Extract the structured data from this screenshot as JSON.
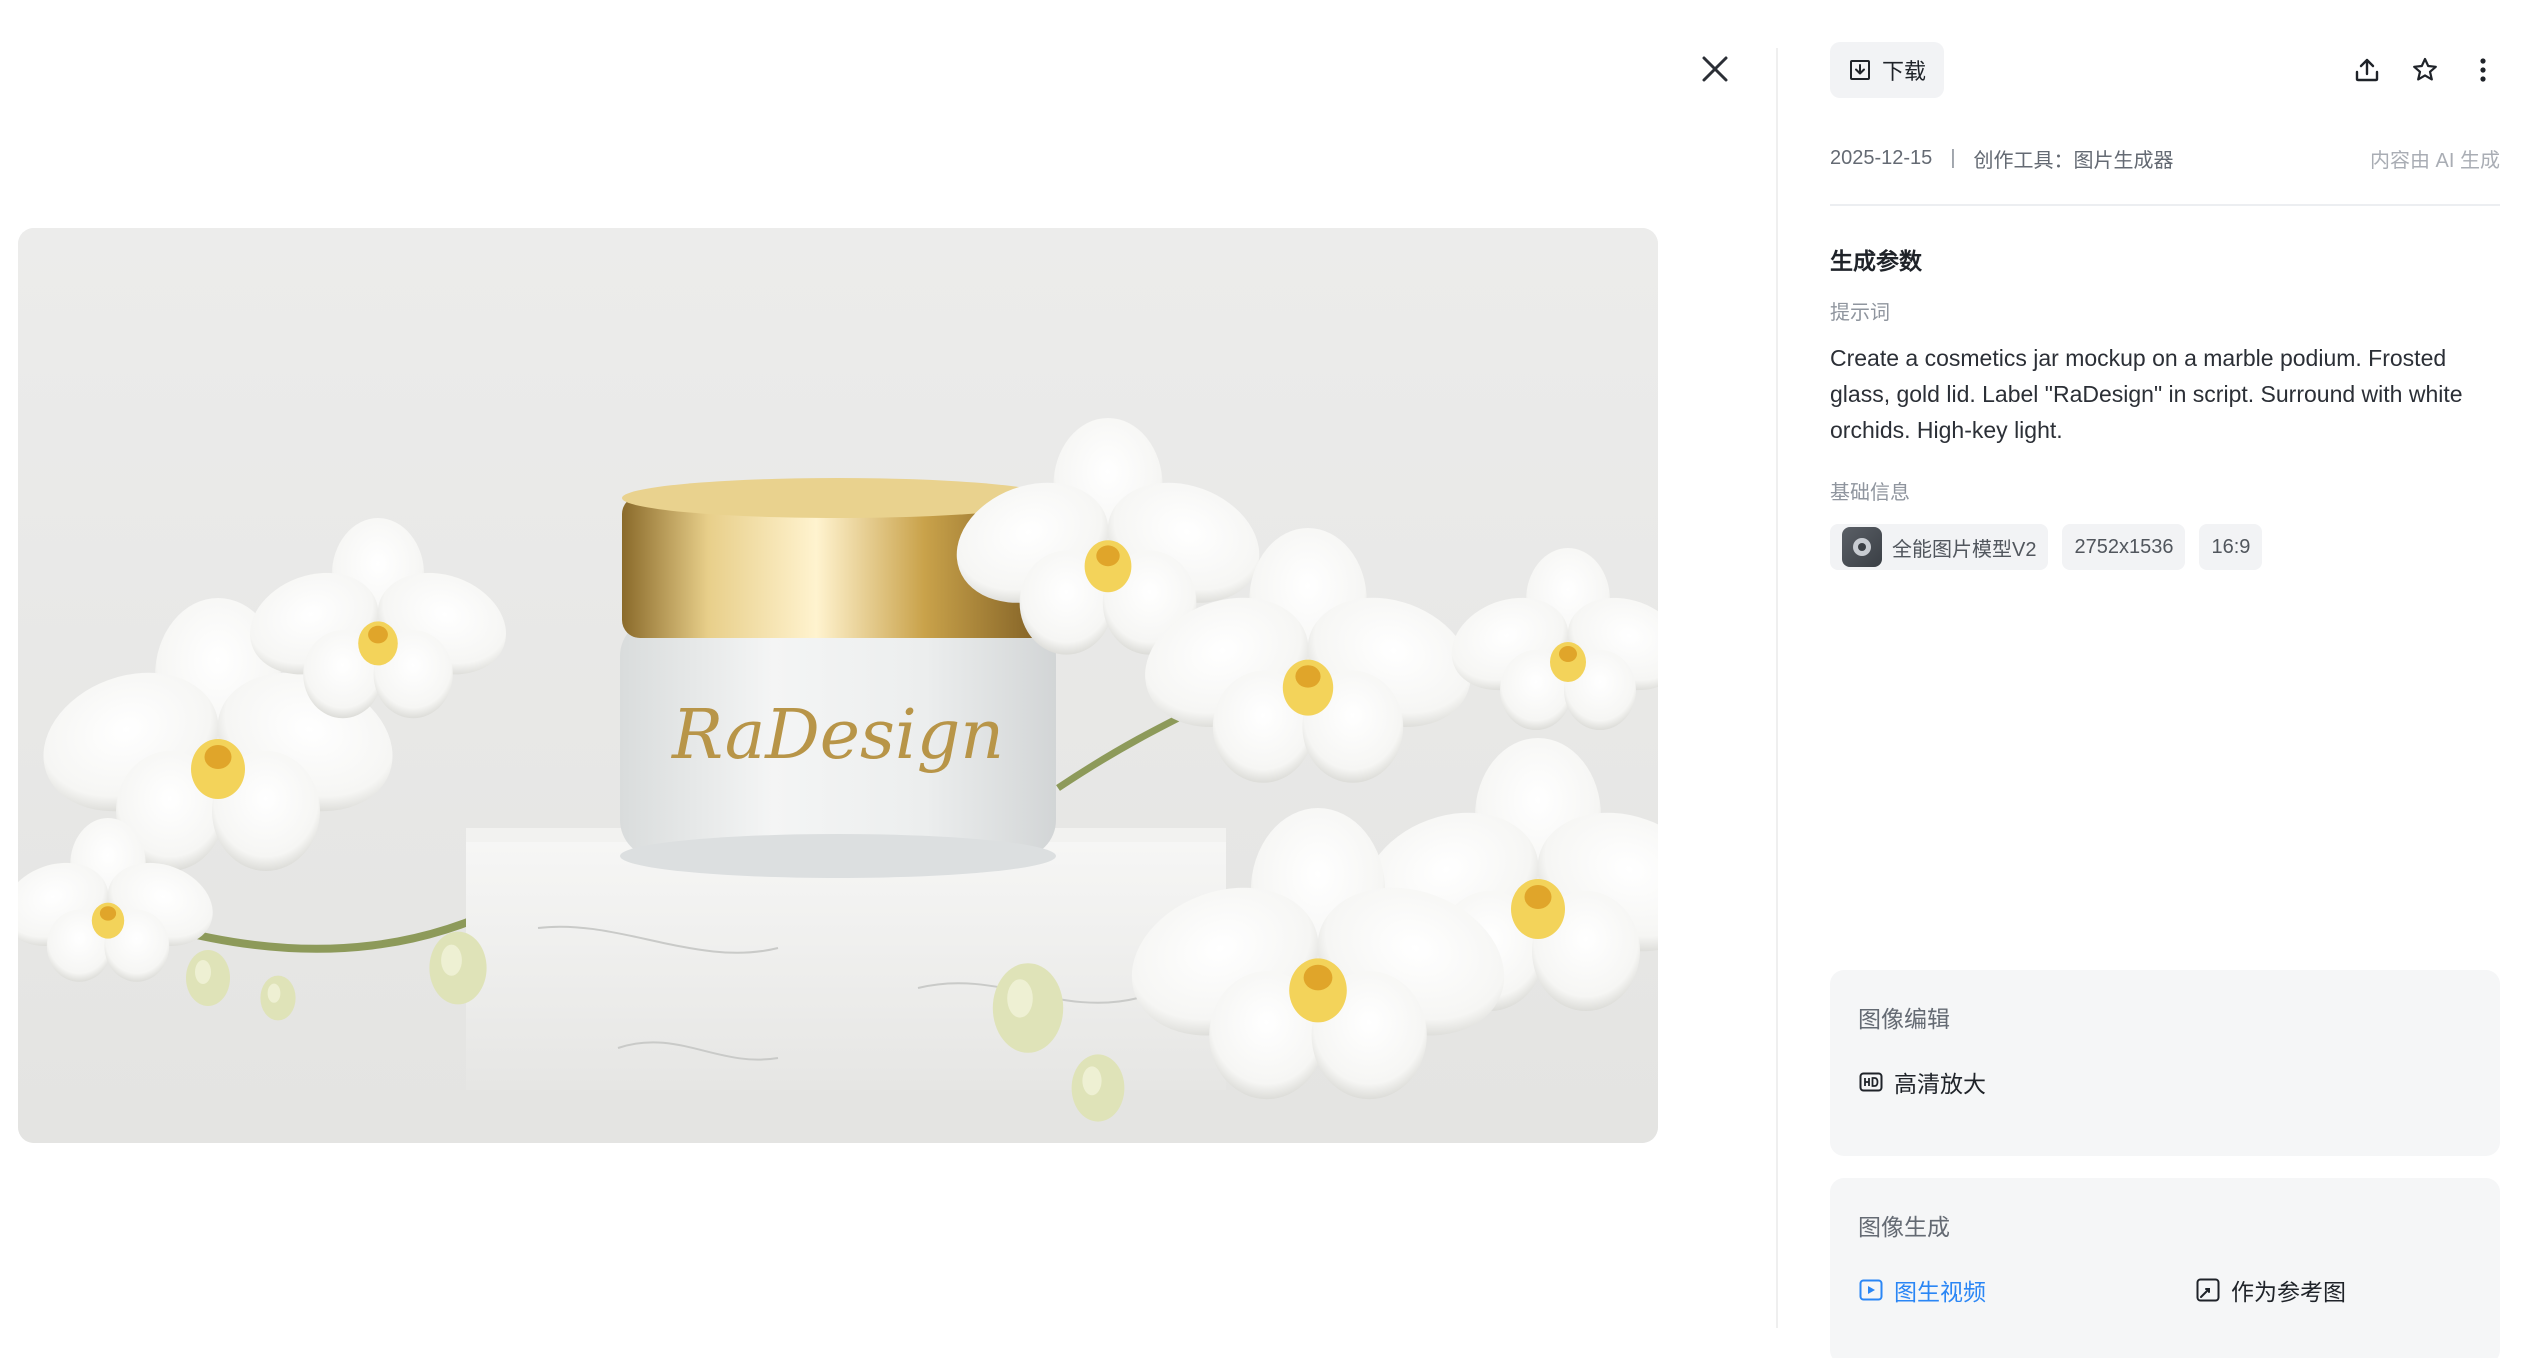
{
  "viewer": {
    "close_icon": "close-icon"
  },
  "toolbar": {
    "download_label": "下载",
    "icons": [
      "share-icon",
      "star-icon",
      "more-vertical-icon"
    ]
  },
  "meta": {
    "date": "2025-12-15",
    "separator": "|",
    "tool": "创作工具：图片生成器",
    "ai_note": "内容由 AI 生成"
  },
  "params": {
    "title": "生成参数",
    "prompt_label": "提示词",
    "prompt_text": "Create a cosmetics jar mockup on a marble podium. Frosted glass, gold lid. Label \"RaDesign\" in script. Surround with white orchids. High-key light.",
    "basic_label": "基础信息",
    "model_name": "全能图片模型V2",
    "resolution": "2752x1536",
    "ratio": "16:9"
  },
  "image": {
    "jar_label": "RaDesign"
  },
  "edit_card": {
    "title": "图像编辑",
    "upscale_label": "高清放大"
  },
  "gen_card": {
    "title": "图像生成",
    "to_video_label": "图生视频",
    "as_reference_label": "作为参考图"
  },
  "colors": {
    "accent": "#2a86f5",
    "card_bg": "#f5f6f7",
    "gold": "#c9a24a"
  }
}
